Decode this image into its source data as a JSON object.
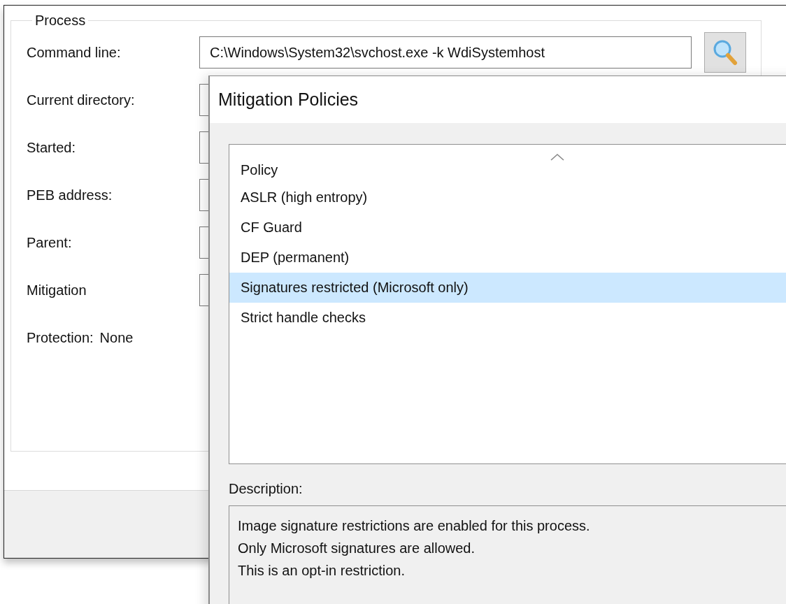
{
  "process_window": {
    "group_title": "Process",
    "fields": [
      {
        "label": "Command line:",
        "kind": "browse",
        "value": "C:\\Windows\\System32\\svchost.exe -k WdiSystemhost"
      },
      {
        "label": "Current directory:",
        "kind": "text"
      },
      {
        "label": "Started:",
        "kind": "text"
      },
      {
        "label": "PEB address:",
        "kind": "text"
      },
      {
        "label": "Parent:",
        "kind": "text"
      },
      {
        "label": "Mitigation",
        "kind": "text"
      },
      {
        "label": "Protection:",
        "kind": "plain",
        "value": "None"
      }
    ]
  },
  "dialog": {
    "title": "Mitigation Policies",
    "list": {
      "column": "Policy",
      "sorted": true,
      "rows": [
        {
          "label": "ASLR (high entropy)",
          "selected": false
        },
        {
          "label": "CF Guard",
          "selected": false
        },
        {
          "label": "DEP (permanent)",
          "selected": false
        },
        {
          "label": "Signatures restricted (Microsoft only)",
          "selected": true
        },
        {
          "label": "Strict handle checks",
          "selected": false
        }
      ]
    },
    "description_label": "Description:",
    "description": [
      "Image signature restrictions are enabled for this process.",
      "Only Microsoft signatures are allowed.",
      "This is an opt-in restriction."
    ]
  }
}
